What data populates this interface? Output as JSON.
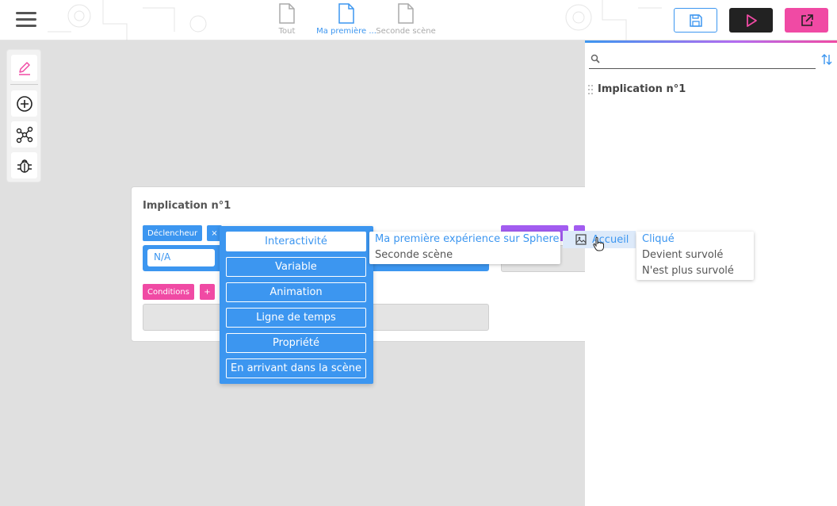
{
  "header": {
    "tabs": [
      {
        "label": "Tout",
        "active": false
      },
      {
        "label": "Ma première ...",
        "active": true
      },
      {
        "label": "Seconde scène",
        "active": false
      }
    ],
    "accent": "#3c96f0",
    "pink": "#f04aa4"
  },
  "right_panel": {
    "search_placeholder": "",
    "item_label": "Implication n°1"
  },
  "card": {
    "title": "Implication n°1",
    "trigger_label": "Déclencheur",
    "trigger_remove": "×",
    "select_value": "N/A",
    "conditions_label": "Conditions",
    "conditions_add": "+"
  },
  "trigger_menu": {
    "items": [
      "Interactivité",
      "Variable",
      "Animation",
      "Ligne de temps",
      "Propriété",
      "En arrivant dans la scène"
    ],
    "selected_index": 0
  },
  "experience_menu": {
    "items": [
      "Ma première expérience sur Sphere",
      "Seconde scène"
    ],
    "highlighted_index": 0
  },
  "scene_menu": {
    "item": "Accueil",
    "icon": "image-icon"
  },
  "event_menu": {
    "items": [
      "Cliqué",
      "Devient survolé",
      "N'est plus survolé"
    ],
    "highlighted_index": 0
  }
}
